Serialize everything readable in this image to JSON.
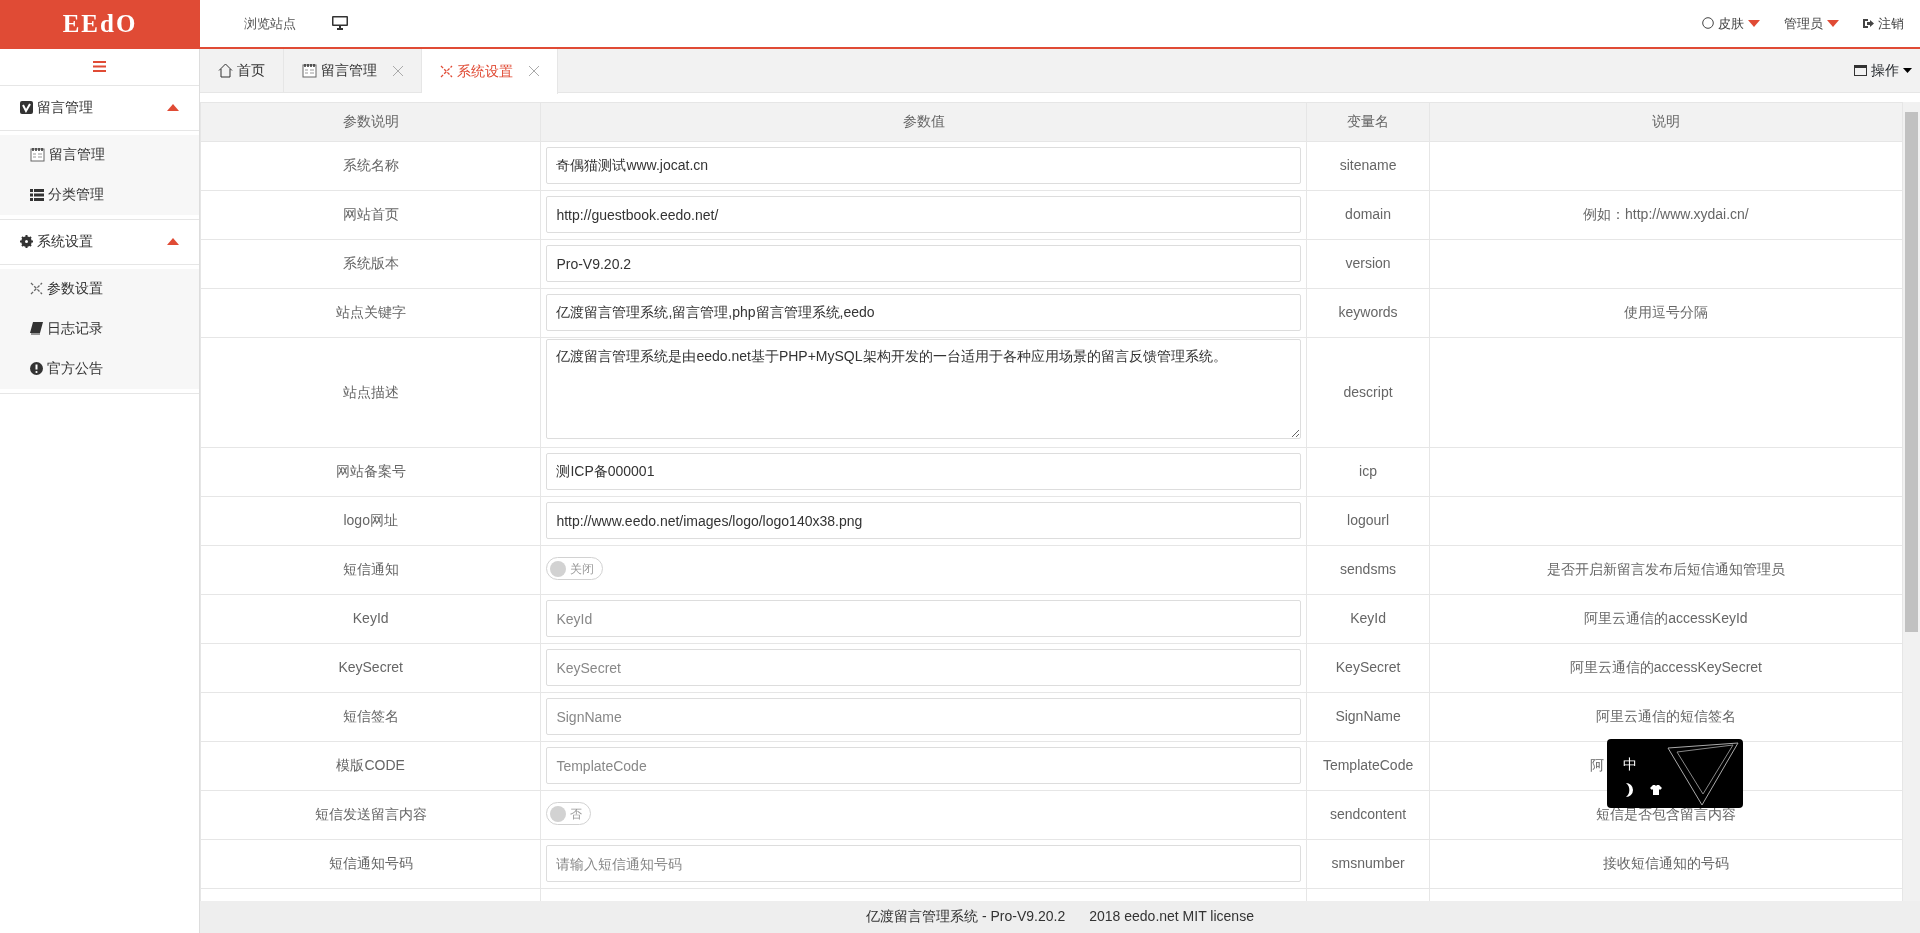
{
  "header": {
    "logo": "EEdO",
    "links": [
      {
        "label": "浏览站点"
      }
    ],
    "right_menu": [
      {
        "kind": "skin",
        "label": "皮肤",
        "dropdown": true
      },
      {
        "kind": "user",
        "label": "管理员",
        "dropdown": true
      },
      {
        "kind": "logout",
        "label": "注销",
        "dropdown": false
      }
    ]
  },
  "sidebar": {
    "groups": [
      {
        "label": "留言管理",
        "kind": "vbadge",
        "expanded": true,
        "children": [
          {
            "label": "留言管理",
            "kind": "notebook"
          },
          {
            "label": "分类管理",
            "kind": "list"
          }
        ]
      },
      {
        "label": "系统设置",
        "kind": "gear",
        "expanded": true,
        "children": [
          {
            "label": "参数设置",
            "kind": "tools"
          },
          {
            "label": "日志记录",
            "kind": "book"
          },
          {
            "label": "官方公告",
            "kind": "alert"
          }
        ]
      }
    ]
  },
  "tabs": [
    {
      "label": "首页",
      "kind": "home",
      "closable": false,
      "selected": false
    },
    {
      "label": "留言管理",
      "kind": "notebook",
      "closable": true,
      "selected": false
    },
    {
      "label": "系统设置",
      "kind": "tools",
      "closable": true,
      "selected": true
    }
  ],
  "tab_actions": {
    "label": "操作"
  },
  "table": {
    "columns": [
      "参数说明",
      "参数值",
      "变量名",
      "说明"
    ],
    "rows": [
      {
        "label": "系统名称",
        "kind": "input",
        "value": "奇偶猫测试www.jocat.cn",
        "variable": "sitename"
      },
      {
        "label": "网站首页",
        "kind": "input",
        "value": "http://guestbook.eedo.net/",
        "variable": "domain",
        "note": "例如：http://www.xydai.cn/"
      },
      {
        "label": "系统版本",
        "kind": "input",
        "value": "Pro-V9.20.2",
        "variable": "version"
      },
      {
        "label": "站点关键字",
        "kind": "input",
        "value": "亿渡留言管理系统,留言管理,php留言管理系统,eedo",
        "variable": "keywords",
        "note": "使用逗号分隔"
      },
      {
        "label": "站点描述",
        "kind": "textarea",
        "value": "亿渡留言管理系统是由eedo.net基于PHP+MySQL架构开发的一台适用于各种应用场景的留言反馈管理系统。",
        "variable": "descript"
      },
      {
        "label": "网站备案号",
        "kind": "input",
        "value": "测ICP备000001",
        "variable": "icp"
      },
      {
        "label": "logo网址",
        "kind": "input",
        "value": "http://www.eedo.net/images/logo/logo140x38.png",
        "variable": "logourl"
      },
      {
        "label": "短信通知",
        "kind": "toggle",
        "toggle_text": "关闭",
        "on": false,
        "variable": "sendsms",
        "note": "是否开启新留言发布后短信通知管理员"
      },
      {
        "label": "KeyId",
        "kind": "input",
        "placeholder": "KeyId",
        "variable": "KeyId",
        "note": "阿里云通信的accessKeyId"
      },
      {
        "label": "KeySecret",
        "kind": "input",
        "placeholder": "KeySecret",
        "variable": "KeySecret",
        "note": "阿里云通信的accessKeySecret"
      },
      {
        "label": "短信签名",
        "kind": "input",
        "placeholder": "SignName",
        "variable": "SignName",
        "note": "阿里云通信的短信签名"
      },
      {
        "label": "模版CODE",
        "kind": "input",
        "placeholder": "TemplateCode",
        "variable": "TemplateCode",
        "note": "阿",
        "note_cut": true
      },
      {
        "label": "短信发送留言内容",
        "kind": "toggle",
        "toggle_text": "否",
        "on": false,
        "variable": "sendcontent",
        "note": "短信是否包含留言内容"
      },
      {
        "label": "短信通知号码",
        "kind": "input",
        "placeholder": "请输入短信通知号码",
        "variable": "smsnumber",
        "note": "接收短信通知的号码"
      }
    ]
  },
  "ime_toolbar": {
    "label": "中"
  },
  "footer": {
    "texts": [
      "亿渡留言管理系统 - Pro-V9.20.2",
      "2018 eedo.net MIT license"
    ]
  }
}
